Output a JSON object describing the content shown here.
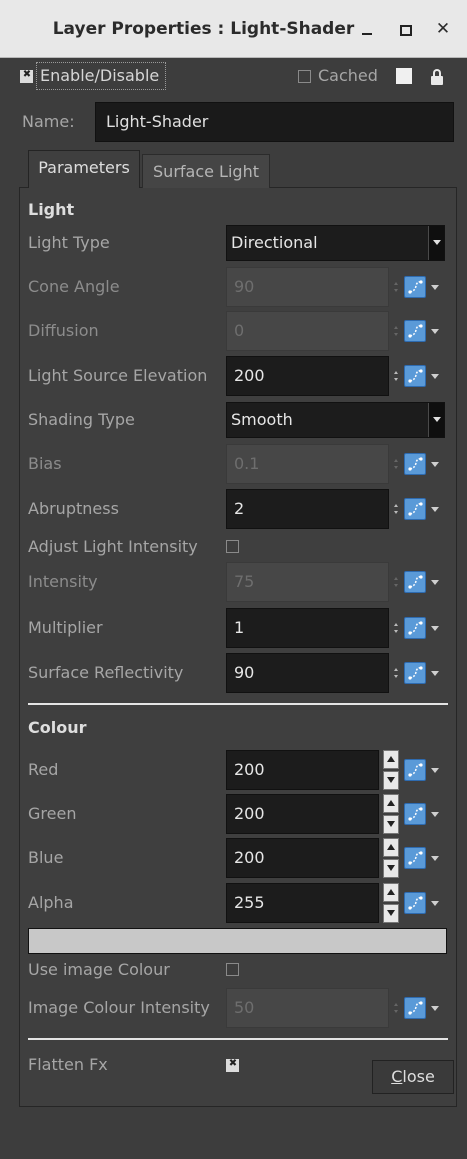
{
  "window": {
    "title": "Layer Properties : Light-Shader",
    "minimize_glyph": "_",
    "maximize_glyph": "□",
    "close_glyph": "✕"
  },
  "header": {
    "enable_label": "Enable/Disable",
    "enable_checked": true,
    "cached_label": "Cached",
    "cached_checked": false,
    "name_label": "Name:",
    "name_value": "Light-Shader"
  },
  "tabs": [
    {
      "label": "Parameters",
      "active": true
    },
    {
      "label": "Surface Light",
      "active": false
    }
  ],
  "light": {
    "heading": "Light",
    "light_type": {
      "label": "Light Type",
      "value": "Directional"
    },
    "cone_angle": {
      "label": "Cone Angle",
      "value": "90",
      "enabled": false
    },
    "diffusion": {
      "label": "Diffusion",
      "value": "0",
      "enabled": false
    },
    "elevation": {
      "label": "Light Source Elevation",
      "value": "200",
      "enabled": true
    },
    "shading_type": {
      "label": "Shading Type",
      "value": "Smooth"
    },
    "bias": {
      "label": "Bias",
      "value": "0.1",
      "enabled": false
    },
    "abruptness": {
      "label": "Abruptness",
      "value": "2",
      "enabled": true
    },
    "adjust_intensity": {
      "label": "Adjust Light Intensity",
      "checked": false
    },
    "intensity": {
      "label": "Intensity",
      "value": "75",
      "enabled": false
    },
    "multiplier": {
      "label": "Multiplier",
      "value": "1",
      "enabled": true
    },
    "reflectivity": {
      "label": "Surface Reflectivity",
      "value": "90",
      "enabled": true
    }
  },
  "colour": {
    "heading": "Colour",
    "red": {
      "label": "Red",
      "value": "200"
    },
    "green": {
      "label": "Green",
      "value": "200"
    },
    "blue": {
      "label": "Blue",
      "value": "200"
    },
    "alpha": {
      "label": "Alpha",
      "value": "255"
    },
    "swatch_color": "#c8c8c8",
    "use_image_colour": {
      "label": "Use image Colour",
      "checked": false
    },
    "image_colour_intensity": {
      "label": "Image Colour Intensity",
      "value": "50",
      "enabled": false
    }
  },
  "flatten": {
    "label": "Flatten Fx",
    "checked": true
  },
  "footer": {
    "close_prefix": "C",
    "close_rest": "lose"
  },
  "colors": {
    "function_button": "#5a9ad8",
    "field_bg": "#1c1c1c",
    "window_bg": "#3d3d3d"
  }
}
